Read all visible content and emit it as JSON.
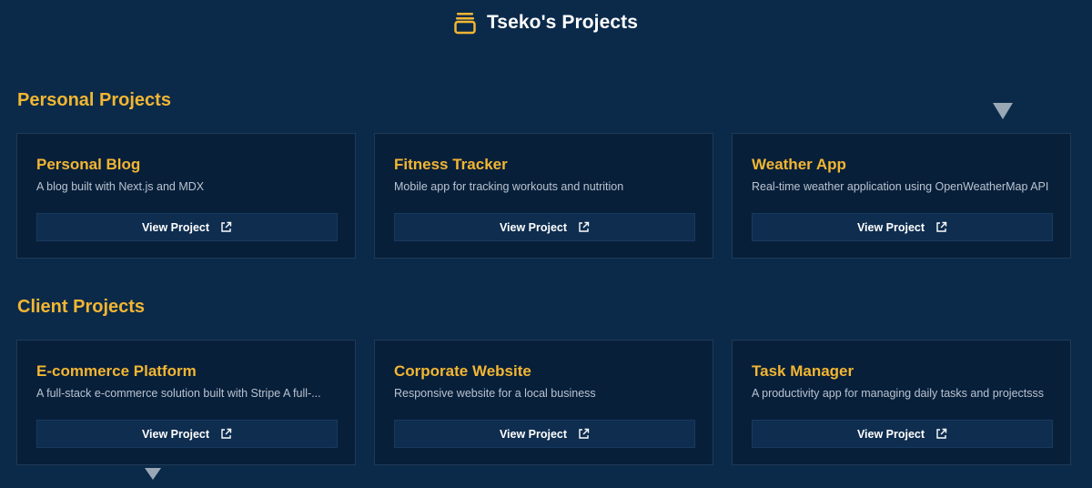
{
  "header": {
    "title": "Tseko's Projects",
    "icon": "stacked-boxes-icon"
  },
  "colors": {
    "background": "#0b2a4a",
    "card": "#081f3a",
    "accent": "#f2b632",
    "button": "#0e2d4f"
  },
  "sections": [
    {
      "title": "Personal Projects",
      "projects": [
        {
          "title": "Personal Blog",
          "description": "A blog built with Next.js and MDX",
          "button": "View Project"
        },
        {
          "title": "Fitness Tracker",
          "description": "Mobile app for tracking workouts and nutrition",
          "button": "View Project"
        },
        {
          "title": "Weather App",
          "description": "Real-time weather application using OpenWeatherMap API",
          "button": "View Project"
        }
      ]
    },
    {
      "title": "Client Projects",
      "projects": [
        {
          "title": "E-commerce Platform",
          "description": "A full-stack e-commerce solution built with Stripe A full-...",
          "button": "View Project"
        },
        {
          "title": "Corporate Website",
          "description": "Responsive website for a local business",
          "button": "View Project"
        },
        {
          "title": "Task Manager",
          "description": "A productivity app for managing daily tasks and projectsss",
          "button": "View Project"
        }
      ]
    }
  ]
}
